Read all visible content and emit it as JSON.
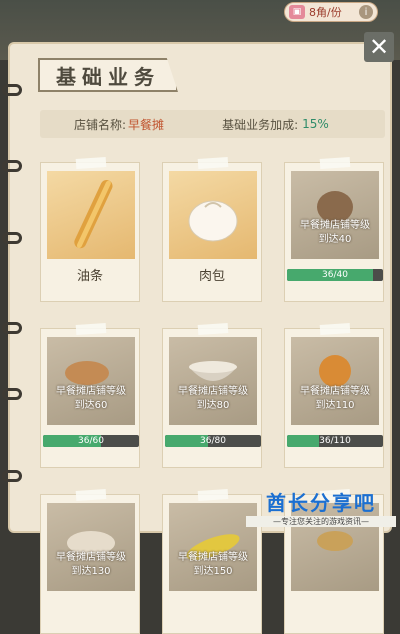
{
  "header": {
    "price_text": "8角/份",
    "gift_icon": "gift-icon",
    "info_icon": "info-icon"
  },
  "panel": {
    "title": "基础业务",
    "close_icon": "close-icon",
    "shop_label": "店铺名称:",
    "shop_name": "早餐摊",
    "bonus_label": "基础业务加成:",
    "bonus_value": "15%"
  },
  "items": [
    {
      "name": "油条",
      "locked": false,
      "icon": "youtiao-icon"
    },
    {
      "name": "肉包",
      "locked": false,
      "icon": "baozi-icon"
    },
    {
      "locked": true,
      "requirement": "早餐摊店铺等级\n到达40",
      "progress_text": "36/40",
      "progress": 0.9,
      "icon": "bun-icon"
    },
    {
      "locked": true,
      "requirement": "早餐摊店铺等级\n到达60",
      "progress_text": "36/60",
      "progress": 0.6,
      "icon": "bread-icon"
    },
    {
      "locked": true,
      "requirement": "早餐摊店铺等级\n到达80",
      "progress_text": "36/80",
      "progress": 0.45,
      "icon": "porridge-icon"
    },
    {
      "locked": true,
      "requirement": "早餐摊店铺等级\n到达110",
      "progress_text": "36/110",
      "progress": 0.33,
      "icon": "sesame-ball-icon"
    },
    {
      "locked": true,
      "requirement": "早餐摊店铺等级\n到达130",
      "icon": "dumplings-icon"
    },
    {
      "locked": true,
      "requirement": "早餐摊店铺等级\n到达150",
      "icon": "corn-icon"
    },
    {
      "locked": true,
      "requirement": "",
      "icon": "pancake-icon"
    }
  ],
  "watermark": {
    "brand": "酋长分享吧",
    "tagline": "—专注您关注的游戏资讯—"
  },
  "colors": {
    "progress_fill": "#47a96d",
    "shop_name": "#c0532e",
    "bonus": "#2f8c69"
  }
}
